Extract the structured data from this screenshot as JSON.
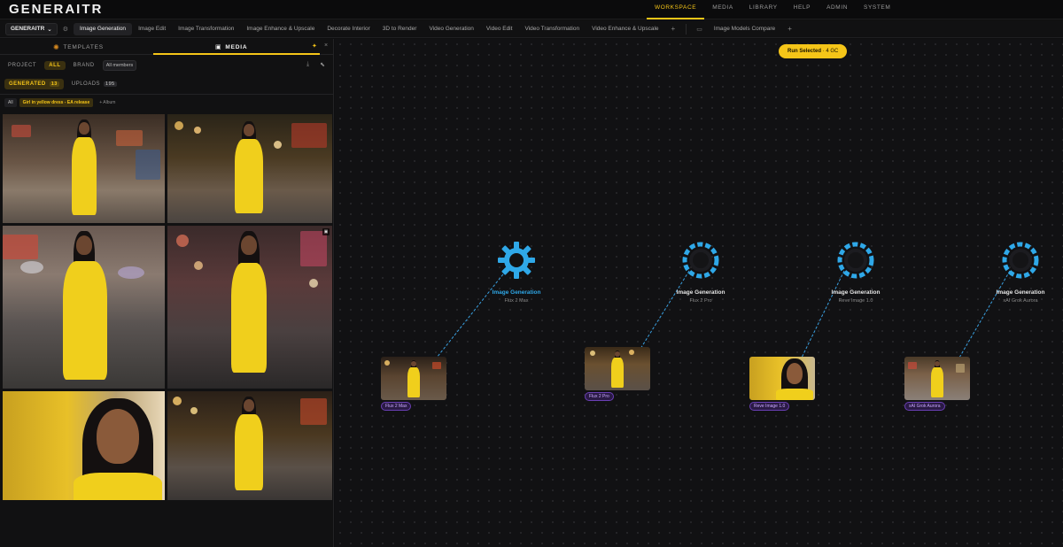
{
  "app": {
    "logo": "GENERAITR"
  },
  "topnav": [
    {
      "label": "WORKSPACE",
      "active": true
    },
    {
      "label": "MEDIA",
      "active": false
    },
    {
      "label": "LIBRARY",
      "active": false
    },
    {
      "label": "HELP",
      "active": false
    },
    {
      "label": "ADMIN",
      "active": false
    },
    {
      "label": "SYSTEM",
      "active": false
    }
  ],
  "tabstrip": {
    "project": "GENERAITR",
    "tabs": [
      {
        "label": "Image Generation",
        "active": true
      },
      {
        "label": "Image Edit"
      },
      {
        "label": "Image Transformation"
      },
      {
        "label": "Image Enhance & Upscale"
      },
      {
        "label": "Decorate Interior"
      },
      {
        "label": "3D to Render"
      },
      {
        "label": "Video Generation"
      },
      {
        "label": "Video Edit"
      },
      {
        "label": "Video Transformation"
      },
      {
        "label": "Video Enhance & Upscale"
      }
    ],
    "plus": "+",
    "compare_tab": "Image Models Compare",
    "plus2": "+"
  },
  "panel": {
    "tab_templates": "TEMPLATES",
    "tab_media": "MEDIA",
    "scope": {
      "project": "PROJECT",
      "all": "ALL",
      "brand": "BRAND",
      "members": "All members"
    },
    "source": {
      "generated": {
        "label": "GENERATED",
        "count": "13"
      },
      "uploads": {
        "label": "UPLOADS",
        "count": "195"
      }
    },
    "albums": {
      "all": "All",
      "active": "Girl in yellow dress - EA release",
      "add": "+ Album"
    }
  },
  "canvas": {
    "run_button": {
      "label": "Run Selected",
      "cost": "· 4 GC"
    },
    "nodes": [
      {
        "title": "Image Generation",
        "model": "Flux 2 Max",
        "active": true,
        "output_label": "Flux 2 Max"
      },
      {
        "title": "Image Generation",
        "model": "Flux 2 Pro",
        "active": false,
        "output_label": "Flux 2 Pro"
      },
      {
        "title": "Image Generation",
        "model": "Reve Image 1.0",
        "active": false,
        "output_label": "Reve Image 1.0"
      },
      {
        "title": "Image Generation",
        "model": "xAI Grok Aurora",
        "active": false,
        "output_label": "xAI Grok Aurora"
      }
    ]
  },
  "colors": {
    "accent": "#f5c518",
    "node_blue": "#2fa8e8",
    "output_purple": "#6a3fb5"
  },
  "icons": {
    "project_chevron": "chevron-down-icon",
    "settings": "gear-icon",
    "templates": "sun-icon",
    "media": "media-icon",
    "pin": "pin-icon",
    "close": "close-icon",
    "download": "download-icon",
    "select": "cursor-icon",
    "compare": "compare-icon"
  }
}
